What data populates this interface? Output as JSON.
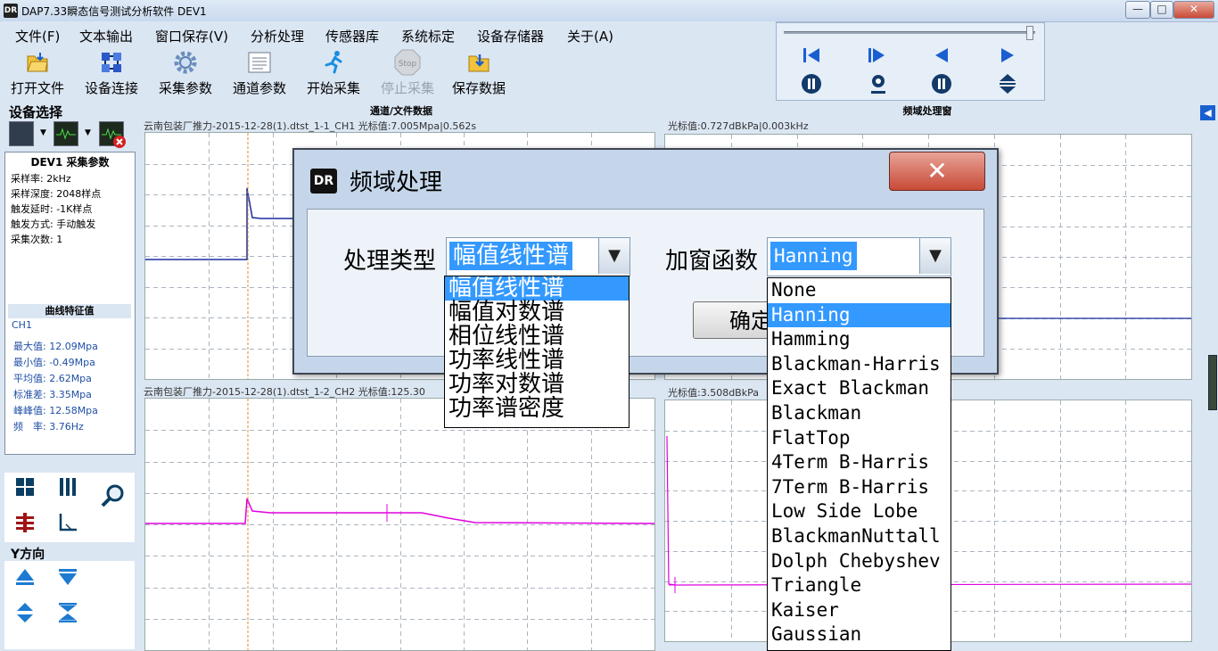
{
  "window": {
    "icon_text": "DR",
    "title": "DAP7.33瞬态信号测试分析软件 DEV1",
    "minimize": "—",
    "maximize": "□",
    "close": "✕"
  },
  "menu": [
    "文件(F)",
    "文本输出",
    "窗口保存(V)",
    "分析处理",
    "传感器库",
    "系统标定",
    "设备存储器",
    "关于(A)"
  ],
  "toolbar": [
    {
      "label": "打开文件",
      "icon": "folder-open-icon",
      "enabled": true
    },
    {
      "label": "设备连接",
      "icon": "network-connect-icon",
      "enabled": true
    },
    {
      "label": "采集参数",
      "icon": "gear-icon",
      "enabled": true
    },
    {
      "label": "通道参数",
      "icon": "list-icon",
      "enabled": true
    },
    {
      "label": "开始采集",
      "icon": "running-man-icon",
      "enabled": true
    },
    {
      "label": "停止采集",
      "icon": "stop-sign-icon",
      "enabled": false
    },
    {
      "label": "保存数据",
      "icon": "folder-save-icon",
      "enabled": true
    }
  ],
  "playback": {
    "slider_position": 1.0,
    "buttons_row1": [
      "skip-to-start-icon",
      "step-forward-icon",
      "play-reverse-icon",
      "play-icon"
    ],
    "buttons_row2": [
      "pause-icon",
      "marker-pin-icon",
      "pause-icon",
      "expand-vertical-icon"
    ]
  },
  "left": {
    "device_select_label": "设备选择",
    "params_title": "DEV1 采集参数",
    "params": [
      "采样率: 2kHz",
      "采样深度: 2048样点",
      "触发延时: -1K样点",
      "触发方式: 手动触发",
      "采集次数: 1"
    ],
    "features_title": "曲线特征值",
    "channel": "CH1",
    "features": [
      "最大值: 12.09Mpa",
      "最小值: -0.49Mpa",
      "平均值: 2.62Mpa",
      "标准差: 3.35Mpa",
      "峰峰值: 12.58Mpa",
      "频　率: 3.76Hz"
    ],
    "y_direction_label": "Y方向"
  },
  "panels": {
    "left_header": "通道/文件数据",
    "right_header": "频域处理窗",
    "ch1_info": "云南包装厂推力-2015-12-28(1).dtst_1-1_CH1  光标值:7.005Mpa|0.562s",
    "ch2_info": "云南包装厂推力-2015-12-28(1).dtst_1-2_CH2  光标值:125.30",
    "fft1_info": "光标值:0.727dBkPa|0.003kHz",
    "fft2_info": "光标值:3.508dBkPa"
  },
  "dialog": {
    "title": "频域处理",
    "type_label": "处理类型",
    "type_value": "幅值线性谱",
    "window_label": "加窗函数",
    "window_value": "Hanning",
    "ok_label": "确定",
    "type_options": [
      "幅值线性谱",
      "幅值对数谱",
      "相位线性谱",
      "功率线性谱",
      "功率对数谱",
      "功率谱密度"
    ],
    "type_selected_index": 0,
    "window_options": [
      "None",
      "Hanning",
      "Hamming",
      "Blackman-Harris",
      "Exact Blackman",
      "Blackman",
      "FlatTop",
      "4Term B-Harris",
      "7Term B-Harris",
      "Low Side Lobe",
      "BlackmanNuttall",
      "Dolph Chebyshev",
      "Triangle",
      "Kaiser",
      "Gaussian"
    ],
    "window_selected_index": 1
  },
  "colors": {
    "ch1_trace": "#1a2fa0",
    "ch2_trace": "#e000e0",
    "grid": "#aab4bf",
    "cursor_line": "#e08a2a",
    "selection": "#3399ff"
  }
}
